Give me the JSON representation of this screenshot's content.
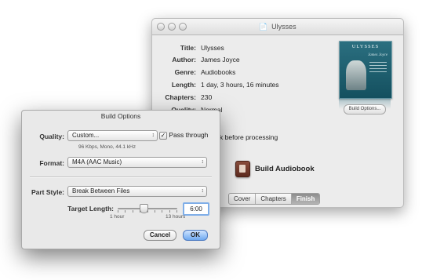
{
  "back_window": {
    "title": "Ulysses",
    "fields": [
      {
        "label": "Title:",
        "value": "Ulysses"
      },
      {
        "label": "Author:",
        "value": "James Joyce"
      },
      {
        "label": "Genre:",
        "value": "Audiobooks"
      },
      {
        "label": "Length:",
        "value": "1 day, 3 hours, 16 minutes"
      },
      {
        "label": "Chapters:",
        "value": "230"
      },
      {
        "label": "Quality:",
        "value": "Normal"
      }
    ],
    "cover": {
      "title": "ULYSSES",
      "author": "James Joyce"
    },
    "build_options_button": "Build Options...",
    "check_label": "k before processing",
    "build_button": "Build Audiobook",
    "tabs": [
      "Cover",
      "Chapters",
      "Finish"
    ],
    "active_tab": "Finish"
  },
  "sheet": {
    "title": "Build Options",
    "quality_label": "Quality:",
    "quality_value": "Custom...",
    "pass_through_label": "Pass through",
    "pass_through_checked": "✓",
    "quality_hint": "96 Kbps, Mono, 44.1 kHz",
    "format_label": "Format:",
    "format_value": "M4A (AAC Music)",
    "part_style_label": "Part Style:",
    "part_style_value": "Break Between Files",
    "target_length_label": "Target Length:",
    "slider_value_fraction": 0.44,
    "target_length_value": "6:00",
    "slider_min_label": "1 hour",
    "slider_max_label": "13 hours",
    "cancel_button": "Cancel",
    "ok_button": "OK"
  }
}
